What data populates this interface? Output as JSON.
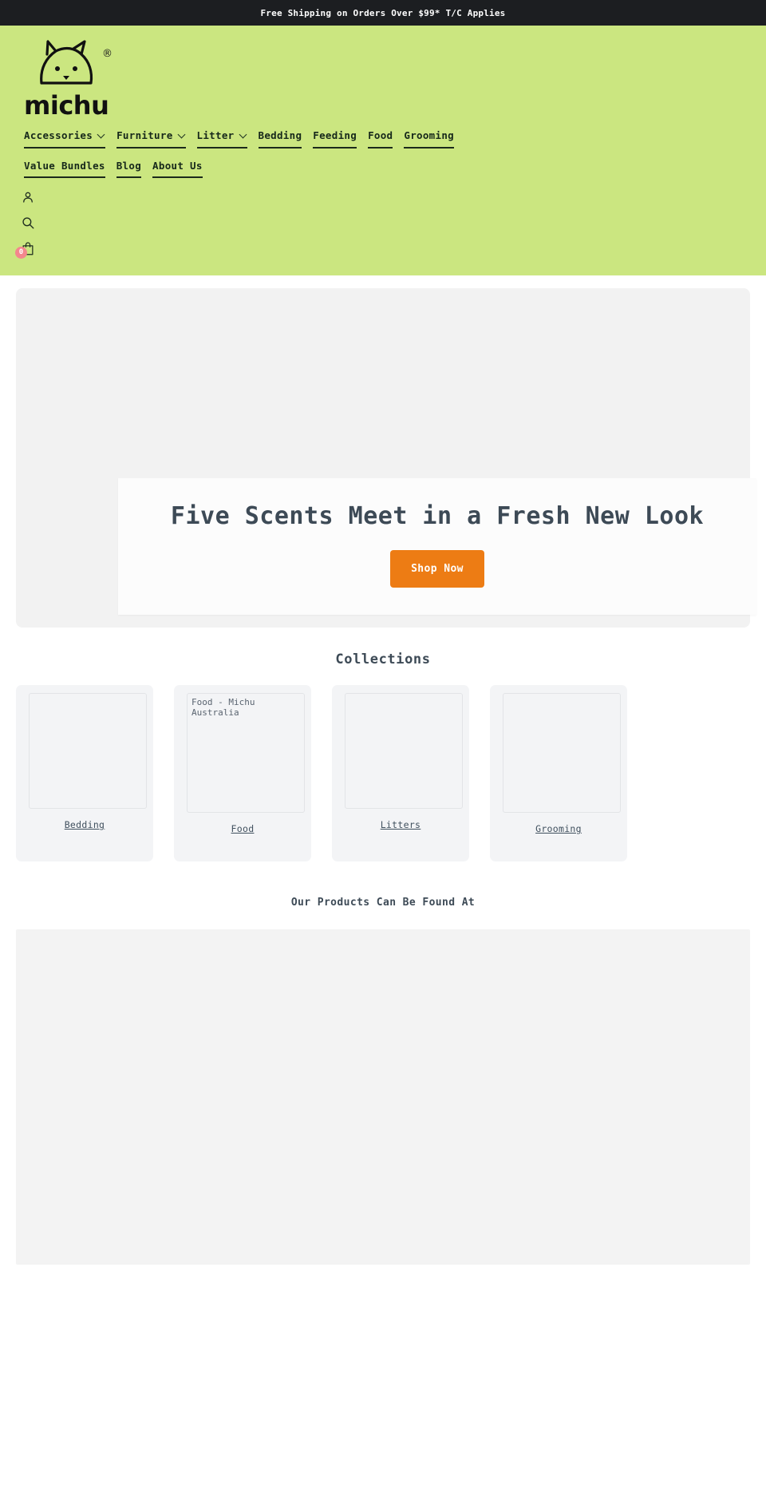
{
  "announcement": {
    "text": "Free Shipping on Orders Over $99* T/C Applies"
  },
  "header": {
    "logo": {
      "wordmark": "michu",
      "registered": "®",
      "icon_name": "cat-face-logo"
    },
    "nav_row_1": [
      {
        "label": "Accessories",
        "has_dropdown": true
      },
      {
        "label": "Furniture",
        "has_dropdown": true
      },
      {
        "label": "Litter",
        "has_dropdown": true
      },
      {
        "label": "Bedding",
        "has_dropdown": false
      },
      {
        "label": "Feeding",
        "has_dropdown": false
      },
      {
        "label": "Food",
        "has_dropdown": false
      },
      {
        "label": "Grooming",
        "has_dropdown": false
      }
    ],
    "nav_row_2": [
      {
        "label": "Value Bundles",
        "has_dropdown": false
      },
      {
        "label": "Blog",
        "has_dropdown": false
      },
      {
        "label": "About Us",
        "has_dropdown": false
      }
    ],
    "icons": [
      {
        "name": "account-icon"
      },
      {
        "name": "search-icon"
      },
      {
        "name": "cart-icon"
      }
    ],
    "cart_count": "0",
    "colors": {
      "header_bg": "#cbe680",
      "announcement_bg": "#1c1e21",
      "badge": "#f4878d"
    }
  },
  "hero": {
    "title": "Five Scents Meet in a Fresh New Look",
    "cta_label": "Shop Now",
    "cta_color": "#ed7c14"
  },
  "collections": {
    "title": "Collections",
    "items": [
      {
        "label": "Bedding",
        "alt_text": ""
      },
      {
        "label": "Food",
        "alt_text": "Food - Michu Australia"
      },
      {
        "label": "Litters",
        "alt_text": ""
      },
      {
        "label": "Grooming",
        "alt_text": ""
      }
    ]
  },
  "found_at": {
    "title": "Our Products Can Be Found At"
  }
}
